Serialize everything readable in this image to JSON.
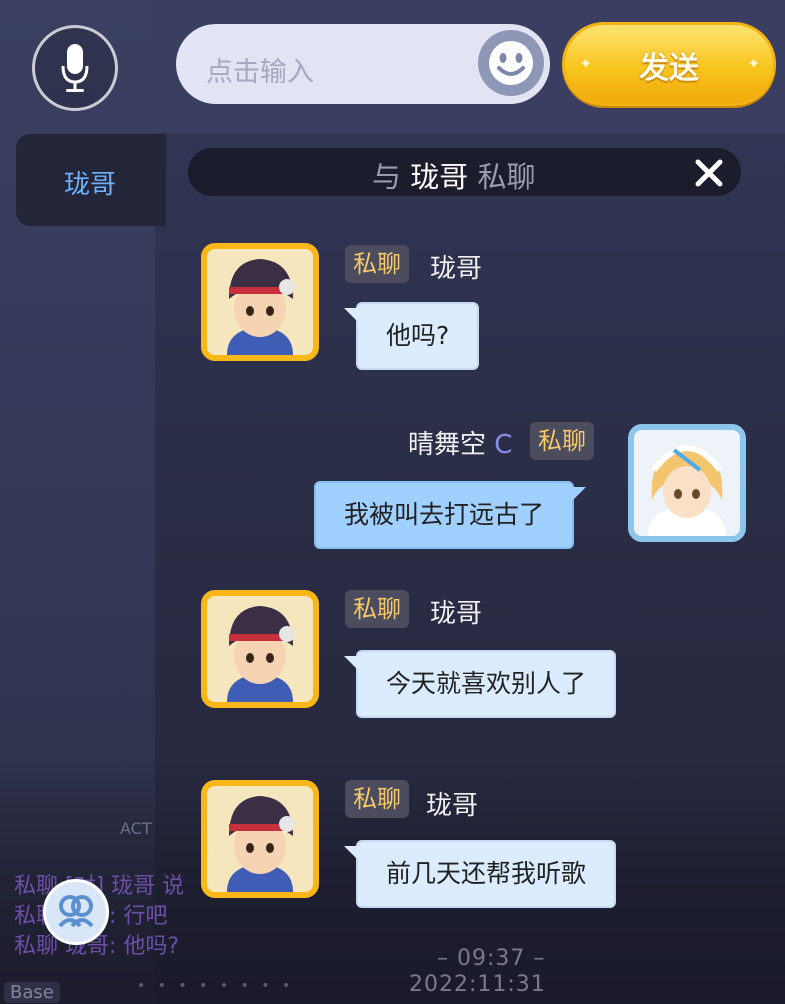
{
  "input": {
    "placeholder": "点击输入"
  },
  "send_button": {
    "label": "发送"
  },
  "contacts": [
    {
      "label": "珑哥"
    }
  ],
  "header": {
    "prefix": "与",
    "name": "珑哥",
    "suffix": "私聊"
  },
  "messages": [
    {
      "side": "left",
      "tag": "私聊",
      "name": "珑哥",
      "text": "他吗?"
    },
    {
      "side": "right",
      "tag": "私聊",
      "name": "晴舞空",
      "name_badge": "C",
      "text": "我被叫去打远古了"
    },
    {
      "side": "left",
      "tag": "私聊",
      "name": "珑哥",
      "text": "今天就喜欢别人了"
    },
    {
      "side": "left",
      "tag": "私聊",
      "name": "珑哥",
      "text": "前几天还帮我听歌"
    }
  ],
  "background": {
    "act_label": "ACT",
    "log_lines": [
      "私聊 [对] 珑哥 说",
      "私聊 珑哥: 行吧",
      "私聊 珑哥: 他吗?"
    ],
    "time": "09:37",
    "date": "2022:11:31",
    "base_label": "Base"
  },
  "icons": {
    "mic": "microphone-icon",
    "emoji": "smiley-icon",
    "close": "close-icon",
    "friends": "friends-icon"
  },
  "colors": {
    "accent_blue": "#6fb2ff",
    "send_yellow": "#f8c51d",
    "tag_gold": "#f5c869"
  }
}
